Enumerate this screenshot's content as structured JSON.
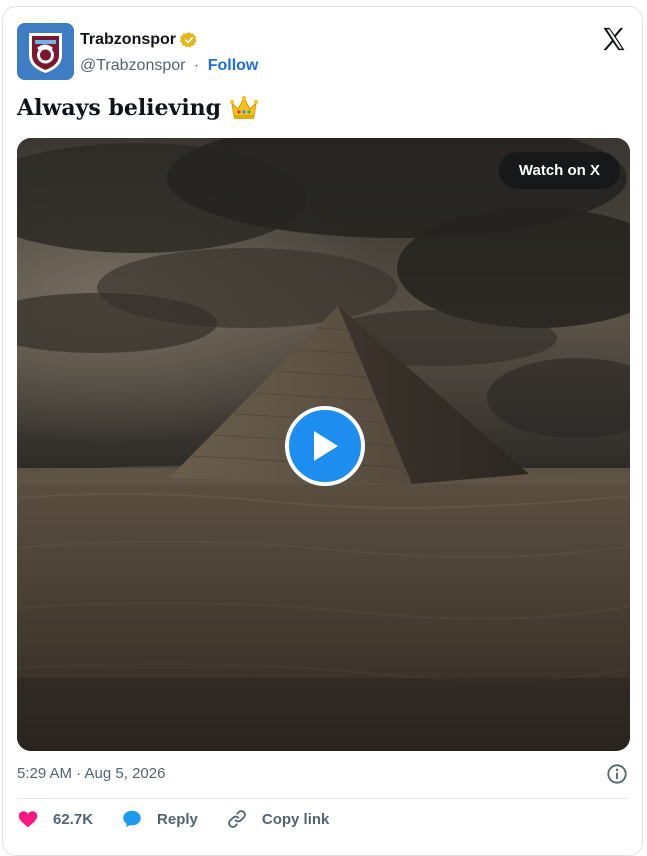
{
  "account": {
    "display_name": "Trabzonspor",
    "handle": "@Trabzonspor",
    "separator": "·",
    "follow_label": "Follow"
  },
  "tweet": {
    "text": "Always believing"
  },
  "media": {
    "watch_label": "Watch on X"
  },
  "meta": {
    "timestamp": "5:29 AM · Aug 5, 2026"
  },
  "actions": {
    "like_count": "62.7K",
    "reply_label": "Reply",
    "copy_label": "Copy link"
  },
  "colors": {
    "accent": "#1d6fd8",
    "like": "#f91880",
    "reply": "#1d9bf0",
    "verified": "#e2b719"
  },
  "icons": [
    "avatar-logo",
    "verified-badge-icon",
    "x-logo-icon",
    "crown-emoji",
    "play-icon",
    "info-icon",
    "heart-icon",
    "reply-bubble-icon",
    "link-icon"
  ]
}
